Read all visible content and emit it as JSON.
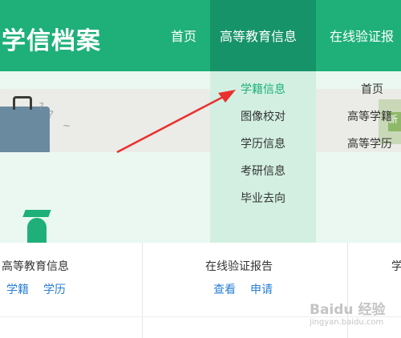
{
  "header": {
    "logo": "学信档案",
    "nav": [
      {
        "label": "首页"
      },
      {
        "label": "高等教育信息"
      },
      {
        "label": "在线验证报"
      }
    ],
    "bg_color": "#1fb07a",
    "active_color": "#17936a"
  },
  "dropdown": {
    "items": [
      "学籍信息",
      "图像校对",
      "学历信息",
      "考研信息",
      "毕业去向"
    ],
    "active_index": 0
  },
  "dropdown2": {
    "items": [
      "首页",
      "高等学籍",
      "高等学历"
    ]
  },
  "banner": {
    "right_text": "新"
  },
  "cards": [
    {
      "title": "高等教育信息",
      "links": [
        "学籍",
        "学历"
      ]
    },
    {
      "title": "在线验证报告",
      "links": [
        "查看",
        "申请"
      ]
    },
    {
      "title": "学"
    }
  ],
  "watermark": {
    "text": "Baidu 经验",
    "url": "jingyan.baidu.com"
  },
  "annotation": {
    "arrow_color": "#e8312f"
  },
  "link_color": "#2a7fd4",
  "icons": [
    "graduation-cap-icon",
    "briefcase-icon",
    "red-arrow"
  ]
}
